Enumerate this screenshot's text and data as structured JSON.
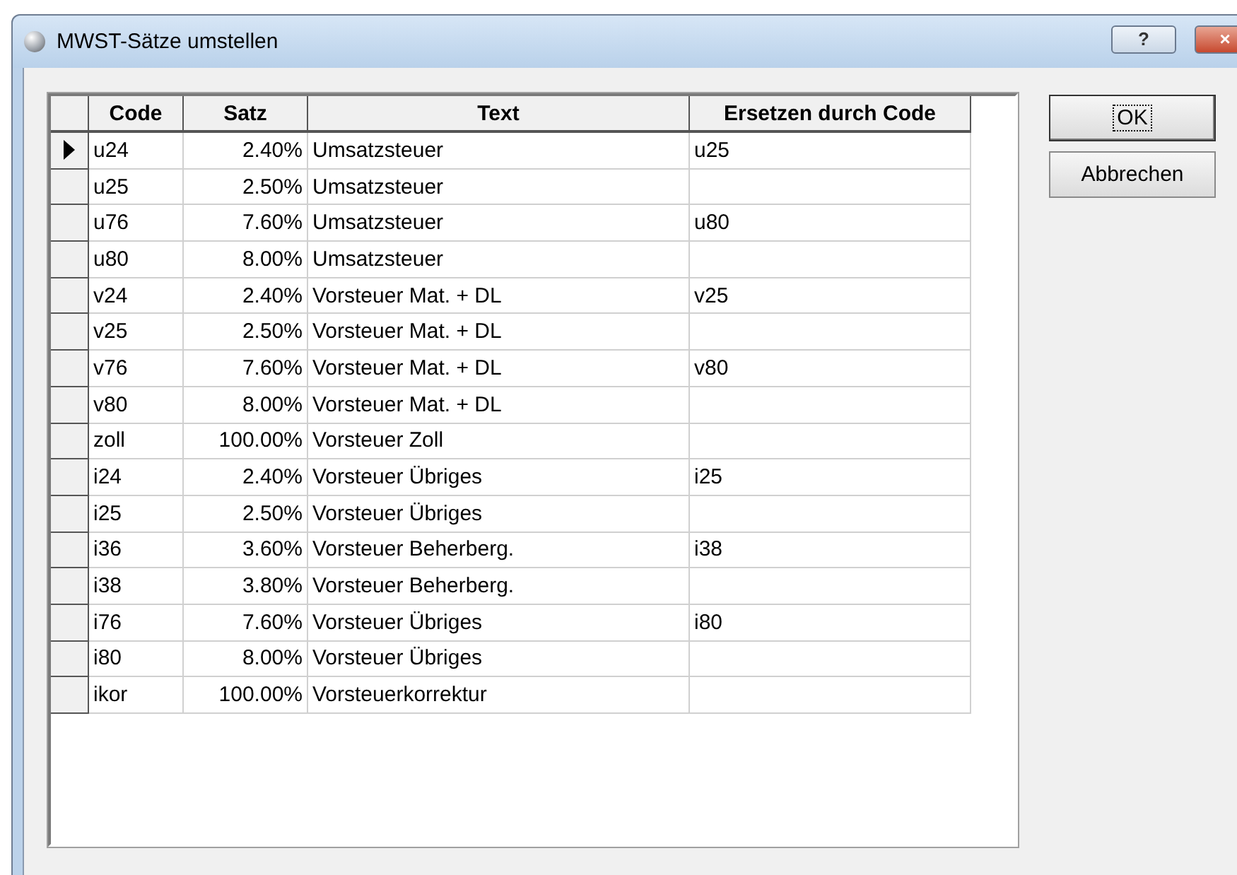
{
  "window": {
    "title": "MWST-Sätze umstellen",
    "help_button": "?",
    "close_button": "×"
  },
  "table": {
    "columns": [
      "Code",
      "Satz",
      "Text",
      "Ersetzen durch Code"
    ],
    "rows": [
      {
        "code": "u24",
        "satz": "2.40%",
        "text": "Umsatzsteuer",
        "replace": "u25",
        "selected": true
      },
      {
        "code": "u25",
        "satz": "2.50%",
        "text": "Umsatzsteuer",
        "replace": "",
        "selected": false
      },
      {
        "code": "u76",
        "satz": "7.60%",
        "text": "Umsatzsteuer",
        "replace": "u80",
        "selected": false
      },
      {
        "code": "u80",
        "satz": "8.00%",
        "text": "Umsatzsteuer",
        "replace": "",
        "selected": false
      },
      {
        "code": "v24",
        "satz": "2.40%",
        "text": "Vorsteuer Mat. + DL",
        "replace": "v25",
        "selected": false
      },
      {
        "code": "v25",
        "satz": "2.50%",
        "text": "Vorsteuer Mat. + DL",
        "replace": "",
        "selected": false
      },
      {
        "code": "v76",
        "satz": "7.60%",
        "text": "Vorsteuer Mat. + DL",
        "replace": "v80",
        "selected": false
      },
      {
        "code": "v80",
        "satz": "8.00%",
        "text": "Vorsteuer Mat. + DL",
        "replace": "",
        "selected": false
      },
      {
        "code": "zoll",
        "satz": "100.00%",
        "text": "Vorsteuer Zoll",
        "replace": "",
        "selected": false
      },
      {
        "code": "i24",
        "satz": "2.40%",
        "text": "Vorsteuer Übriges",
        "replace": "i25",
        "selected": false
      },
      {
        "code": "i25",
        "satz": "2.50%",
        "text": "Vorsteuer Übriges",
        "replace": "",
        "selected": false
      },
      {
        "code": "i36",
        "satz": "3.60%",
        "text": "Vorsteuer Beherberg.",
        "replace": "i38",
        "selected": false
      },
      {
        "code": "i38",
        "satz": "3.80%",
        "text": "Vorsteuer Beherberg.",
        "replace": "",
        "selected": false
      },
      {
        "code": "i76",
        "satz": "7.60%",
        "text": "Vorsteuer Übriges",
        "replace": "i80",
        "selected": false
      },
      {
        "code": "i80",
        "satz": "8.00%",
        "text": "Vorsteuer Übriges",
        "replace": "",
        "selected": false
      },
      {
        "code": "ikor",
        "satz": "100.00%",
        "text": "Vorsteuerkorrektur",
        "replace": "",
        "selected": false
      }
    ]
  },
  "buttons": [
    {
      "label": "OK",
      "focused": true
    },
    {
      "label": "Abbrechen",
      "focused": false
    }
  ]
}
